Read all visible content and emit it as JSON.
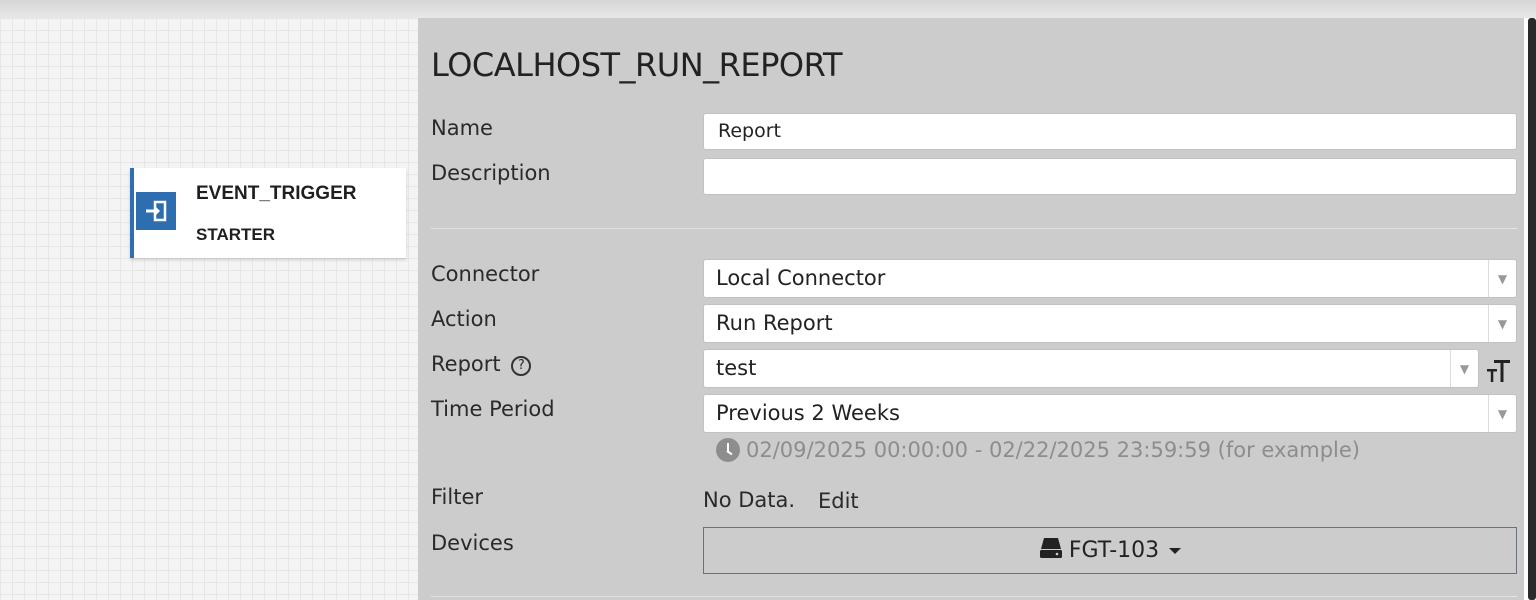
{
  "node": {
    "title": "EVENT_TRIGGER",
    "subtitle": "STARTER",
    "icon": "sign-in-icon",
    "accent": "#2f6fb0"
  },
  "panel": {
    "title": "LOCALHOST_RUN_REPORT",
    "name_label": "Name",
    "name_value": "Report",
    "description_label": "Description",
    "description_value": "",
    "connector_label": "Connector",
    "connector_value": "Local Connector",
    "action_label": "Action",
    "action_value": "Run Report",
    "report_label": "Report",
    "report_help": "?",
    "report_value": "test",
    "time_period_label": "Time Period",
    "time_period_value": "Previous 2 Weeks",
    "time_period_hint": "02/09/2025 00:00:00 - 02/22/2025 23:59:59 (for example)",
    "filter_label": "Filter",
    "filter_value": "No Data.",
    "filter_edit": "Edit",
    "devices_label": "Devices",
    "device_value": "FGT-103"
  },
  "colors": {
    "panel_bg": "#cccccc",
    "accent_blue": "#2c6eaf"
  }
}
